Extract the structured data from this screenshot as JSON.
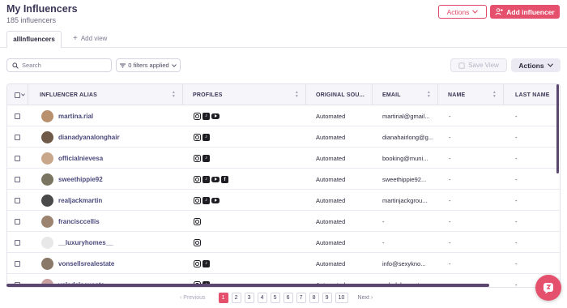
{
  "header": {
    "title": "My Influencers",
    "subtitle": "185 influencers"
  },
  "top_actions": {
    "actions_label": "Actions",
    "add_label": "Add influencer"
  },
  "tabs": {
    "active": "allInfluencers",
    "add_view": "Add view"
  },
  "toolbar": {
    "search_placeholder": "Search",
    "filters_label": "0 filters applied",
    "save_view_label": "Save View",
    "actions_label": "Actions"
  },
  "table": {
    "columns": [
      "INFLUENCER ALIAS",
      "PROFILES",
      "ORIGINAL SOU...",
      "EMAIL",
      "NAME",
      "LAST NAME"
    ],
    "rows": [
      {
        "alias": "martina.rial",
        "profiles": [
          "instagram",
          "tiktok",
          "youtube"
        ],
        "source": "Automated",
        "email": "martirial@gmail...",
        "name": "-",
        "last_name": "-"
      },
      {
        "alias": "dianadyanalonghair",
        "profiles": [
          "instagram",
          "tiktok"
        ],
        "source": "Automated",
        "email": "dianahairlong@g...",
        "name": "-",
        "last_name": "-"
      },
      {
        "alias": "officialnievesa",
        "profiles": [
          "instagram",
          "tiktok"
        ],
        "source": "Automated",
        "email": "booking@muni...",
        "name": "-",
        "last_name": "-"
      },
      {
        "alias": "sweethippie92",
        "profiles": [
          "instagram",
          "tiktok",
          "youtube",
          "facebook"
        ],
        "source": "Automated",
        "email": "sweethippie92...",
        "name": "-",
        "last_name": "-"
      },
      {
        "alias": "realjackmartin",
        "profiles": [
          "instagram",
          "tiktok",
          "youtube"
        ],
        "source": "Automated",
        "email": "martinjackgrou...",
        "name": "-",
        "last_name": "-"
      },
      {
        "alias": "francisccellis",
        "profiles": [
          "instagram"
        ],
        "source": "Automated",
        "email": "-",
        "name": "-",
        "last_name": "-"
      },
      {
        "alias": "__luxuryhomes__",
        "profiles": [
          "instagram"
        ],
        "source": "Automated",
        "email": "-",
        "name": "-",
        "last_name": "-"
      },
      {
        "alias": "vonsellsrealestate",
        "profiles": [
          "instagram",
          "tiktok"
        ],
        "source": "Automated",
        "email": "info@sexykno...",
        "name": "-",
        "last_name": "-"
      },
      {
        "alias": "valedelacuesta",
        "profiles": [
          "instagram",
          "tiktok"
        ],
        "source": "Automated",
        "email": "valedelacuesta...",
        "name": "-",
        "last_name": "-"
      }
    ]
  },
  "pagination": {
    "previous": "Previous",
    "next": "Next",
    "pages": [
      "1",
      "2",
      "3",
      "4",
      "5",
      "6",
      "7",
      "8",
      "9",
      "10"
    ],
    "current": "1"
  },
  "colors": {
    "brand": "#e5506c",
    "alias_text": "#4b4a7c",
    "scrollbar": "#5a466e"
  },
  "icons": {
    "add_influencer": "person-plus-icon",
    "chevron": "chevron-down-icon",
    "search": "search-icon",
    "filter": "filter-icon",
    "save": "bookmark-icon",
    "chat": "chat-icon"
  }
}
